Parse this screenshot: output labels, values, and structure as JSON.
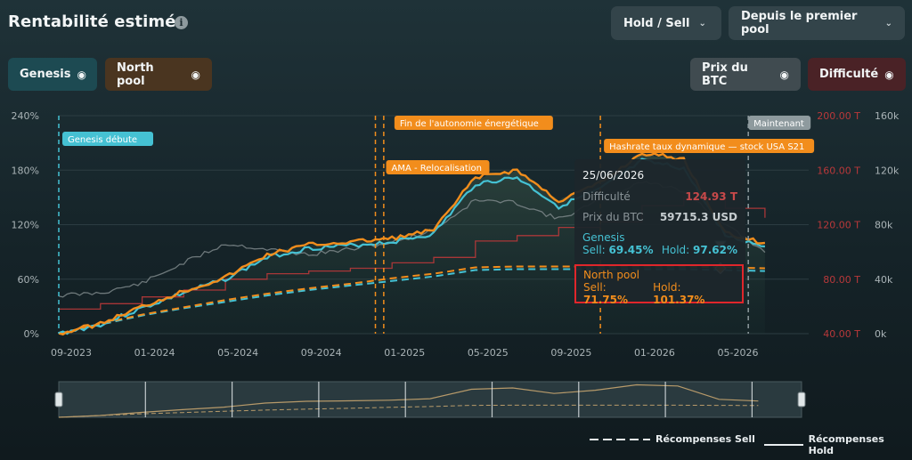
{
  "header": {
    "title": "Rentabilité estimée",
    "info_icon": "info-icon",
    "mode_dropdown": "Hold / Sell",
    "period_dropdown": "Depuis le premier pool"
  },
  "toggles": {
    "genesis": {
      "label": "Genesis",
      "color": "#1d4a52",
      "icon": "eye-icon"
    },
    "north_pool": {
      "label": "North pool",
      "color": "#4a3520",
      "icon": "eye-icon"
    },
    "btc_price": {
      "label": "Prix du BTC",
      "color": "#404b50",
      "icon": "eye-icon"
    },
    "difficulty": {
      "label": "Difficulté",
      "color": "#4a2226",
      "icon": "eye-icon"
    }
  },
  "colors": {
    "genesis": "#45c1d3",
    "north_pool": "#f28d1c",
    "btc_price": "#7d878a",
    "difficulty": "#b8383a",
    "grid": "#2c3c42"
  },
  "chart_data": {
    "type": "line",
    "x_ticks": [
      "09-2023",
      "01-2024",
      "05-2024",
      "09-2024",
      "01-2025",
      "05-2025",
      "09-2025",
      "01-2026",
      "05-2026"
    ],
    "y_left": {
      "ticks": [
        "0%",
        "60%",
        "120%",
        "180%",
        "240%"
      ],
      "ylim": [
        0,
        240
      ]
    },
    "y_right_difficulty": {
      "ticks": [
        "40.00 T",
        "80.00 T",
        "120.00 T",
        "160.00 T",
        "200.00 T"
      ],
      "ylim": [
        40,
        200
      ]
    },
    "y_right_btc": {
      "ticks": [
        "0k",
        "40k",
        "80k",
        "120k",
        "160k"
      ],
      "ylim": [
        0,
        160000
      ]
    },
    "x_months": [
      0,
      2,
      4,
      6,
      8,
      10,
      12,
      14,
      16,
      18,
      20,
      22,
      24,
      26,
      28,
      30,
      32,
      33.9
    ],
    "series": [
      {
        "name": "Genesis",
        "style": "hold",
        "values": [
          0,
          10,
          28,
          45,
          60,
          84,
          94,
          97,
          101,
          110,
          165,
          172,
          140,
          159,
          190,
          182,
          108,
          96
        ]
      },
      {
        "name": "North pool",
        "style": "hold",
        "values": [
          0,
          11,
          30,
          47,
          62,
          87,
          98,
          101,
          105,
          114,
          172,
          180,
          146,
          166,
          199,
          192,
          110,
          100
        ]
      },
      {
        "name": "Genesis",
        "style": "sell",
        "values": [
          0,
          10,
          20,
          28,
          35,
          42,
          48,
          53,
          58,
          63,
          70,
          71,
          71,
          71,
          71,
          71,
          70,
          69
        ]
      },
      {
        "name": "North pool",
        "style": "sell",
        "values": [
          0,
          11,
          21,
          29,
          37,
          44,
          50,
          55,
          61,
          66,
          73,
          74,
          74,
          74,
          74,
          74,
          73,
          72
        ]
      },
      {
        "name": "Prix du BTC",
        "axis": "btc",
        "values": [
          28000,
          30000,
          37000,
          52000,
          66000,
          62000,
          58000,
          62000,
          67000,
          76000,
          98000,
          96000,
          84000,
          98000,
          112000,
          105000,
          80000,
          59715
        ]
      },
      {
        "name": "Difficulté",
        "axis": "difficulty",
        "values": [
          58,
          62,
          67,
          72,
          80,
          84,
          86,
          88,
          92,
          96,
          108,
          112,
          118,
          122,
          134,
          140,
          132,
          125
        ]
      }
    ],
    "events": [
      {
        "label": "Genesis débute",
        "month": 0,
        "color": "#45c1d3"
      },
      {
        "label": "Fin de l'autonomie énergétique",
        "month": 15.6,
        "color": "#f28d1c"
      },
      {
        "label": "AMA - Relocalisation",
        "month": 15.2,
        "color": "#f28d1c"
      },
      {
        "label": "Hashrate taux dynamique — stock USA S21",
        "month": 26,
        "color": "#f28d1c"
      },
      {
        "label": "Maintenant",
        "month": 33.1,
        "color": "#8e9a9e"
      }
    ]
  },
  "tooltip": {
    "date": "25/06/2026",
    "difficulty_label": "Difficulté",
    "difficulty_value": "124.93 T",
    "btc_label": "Prix du BTC",
    "btc_value": "59715.3 USD",
    "genesis_title": "Genesis",
    "genesis_sell_label": "Sell:",
    "genesis_sell": "69.45%",
    "genesis_hold_label": "Hold:",
    "genesis_hold": "97.62%",
    "np_title": "North pool",
    "np_sell_label": "Sell:",
    "np_sell": "71.75%",
    "np_hold_label": "Hold:",
    "np_hold": "101.37%"
  },
  "legend": {
    "sell": "Récompenses Sell",
    "hold": "Récompenses Hold"
  }
}
